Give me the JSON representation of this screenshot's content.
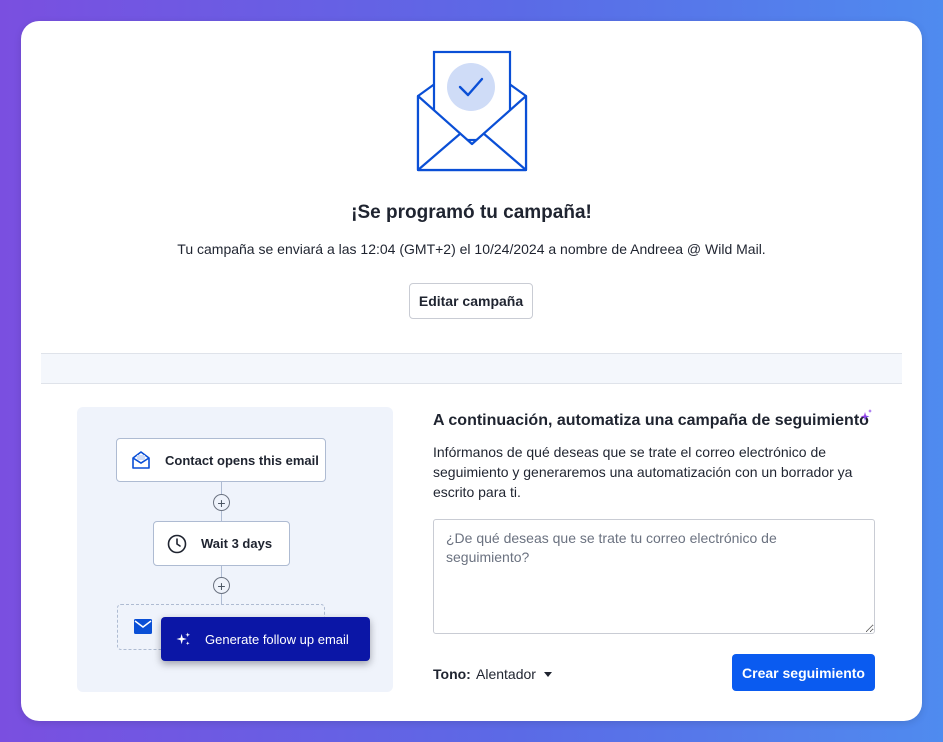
{
  "colors": {
    "accent": "#0a5bf0",
    "generate_button": "#0b16a6",
    "illustration_stroke": "#0a4fd6",
    "illustration_circle": "#cfdcf7",
    "panel_background": "#eff3fb"
  },
  "hero": {
    "icon": "envelope-check-icon",
    "title": "¡Se programó tu campaña!",
    "subtitle": "Tu campaña se enviará a las 12:04 (GMT+2) el 10/24/2024 a nombre de Andreea @ Wild Mail.",
    "edit_button": "Editar campaña"
  },
  "flow": {
    "trigger": {
      "icon": "envelope-open-icon",
      "label": "Contact opens this email"
    },
    "wait": {
      "icon": "clock-icon",
      "label": "Wait 3 days"
    },
    "placeholder_icon": "envelope-icon",
    "generate_button": {
      "icon": "sparkles-icon",
      "label": "Generate follow up email"
    }
  },
  "automate": {
    "title": "A continuación, automatiza una campaña de seguimiento",
    "title_icon": "sparkle-icon",
    "description": "Infórmanos de qué deseas que se trate el correo electrónico de seguimiento y generaremos una automatización con un borrador ya escrito para ti.",
    "prompt_placeholder": "¿De qué deseas que se trate tu correo electrónico de seguimiento?",
    "prompt_value": "",
    "tone_label": "Tono:",
    "tone_value": "Alentador",
    "create_button": "Crear seguimiento"
  }
}
